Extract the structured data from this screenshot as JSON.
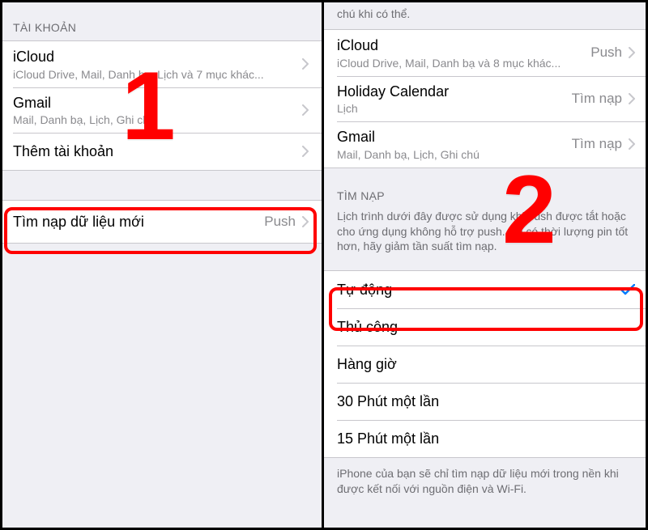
{
  "annotations": {
    "num1": "1",
    "num2": "2"
  },
  "left": {
    "section_accounts": "TÀI KHOẢN",
    "accounts": [
      {
        "title": "iCloud",
        "sub": "iCloud Drive, Mail, Danh bạ, Lịch và 7 mục khác..."
      },
      {
        "title": "Gmail",
        "sub": "Mail, Danh bạ, Lịch, Ghi chú"
      }
    ],
    "add_account": "Thêm tài khoản",
    "fetch_row": {
      "title": "Tìm nạp dữ liệu mới",
      "value": "Push"
    }
  },
  "right": {
    "top_fragment": "chú khi có thể.",
    "accounts": [
      {
        "title": "iCloud",
        "sub": "iCloud Drive, Mail, Danh bạ và 8 mục khác...",
        "value": "Push"
      },
      {
        "title": "Holiday Calendar",
        "sub": "Lịch",
        "value": "Tìm nạp"
      },
      {
        "title": "Gmail",
        "sub": "Mail, Danh bạ, Lịch, Ghi chú",
        "value": "Tìm nạp"
      }
    ],
    "section_fetch": "TÌM NẠP",
    "fetch_desc": "Lịch trình dưới đây được sử dụng khi push được tắt hoặc cho ứng dụng không hỗ trợ push. Để có thời lượng pin tốt hơn, hãy giảm tần suất tìm nạp.",
    "schedule": [
      {
        "label": "Tự động",
        "selected": true
      },
      {
        "label": "Thủ công",
        "selected": false
      },
      {
        "label": "Hàng giờ",
        "selected": false
      },
      {
        "label": "30 Phút một lần",
        "selected": false
      },
      {
        "label": "15 Phút một lần",
        "selected": false
      }
    ],
    "bottom_note": "iPhone của bạn sẽ chỉ tìm nạp dữ liệu mới trong nền khi được kết nối với nguồn điện và Wi-Fi."
  }
}
